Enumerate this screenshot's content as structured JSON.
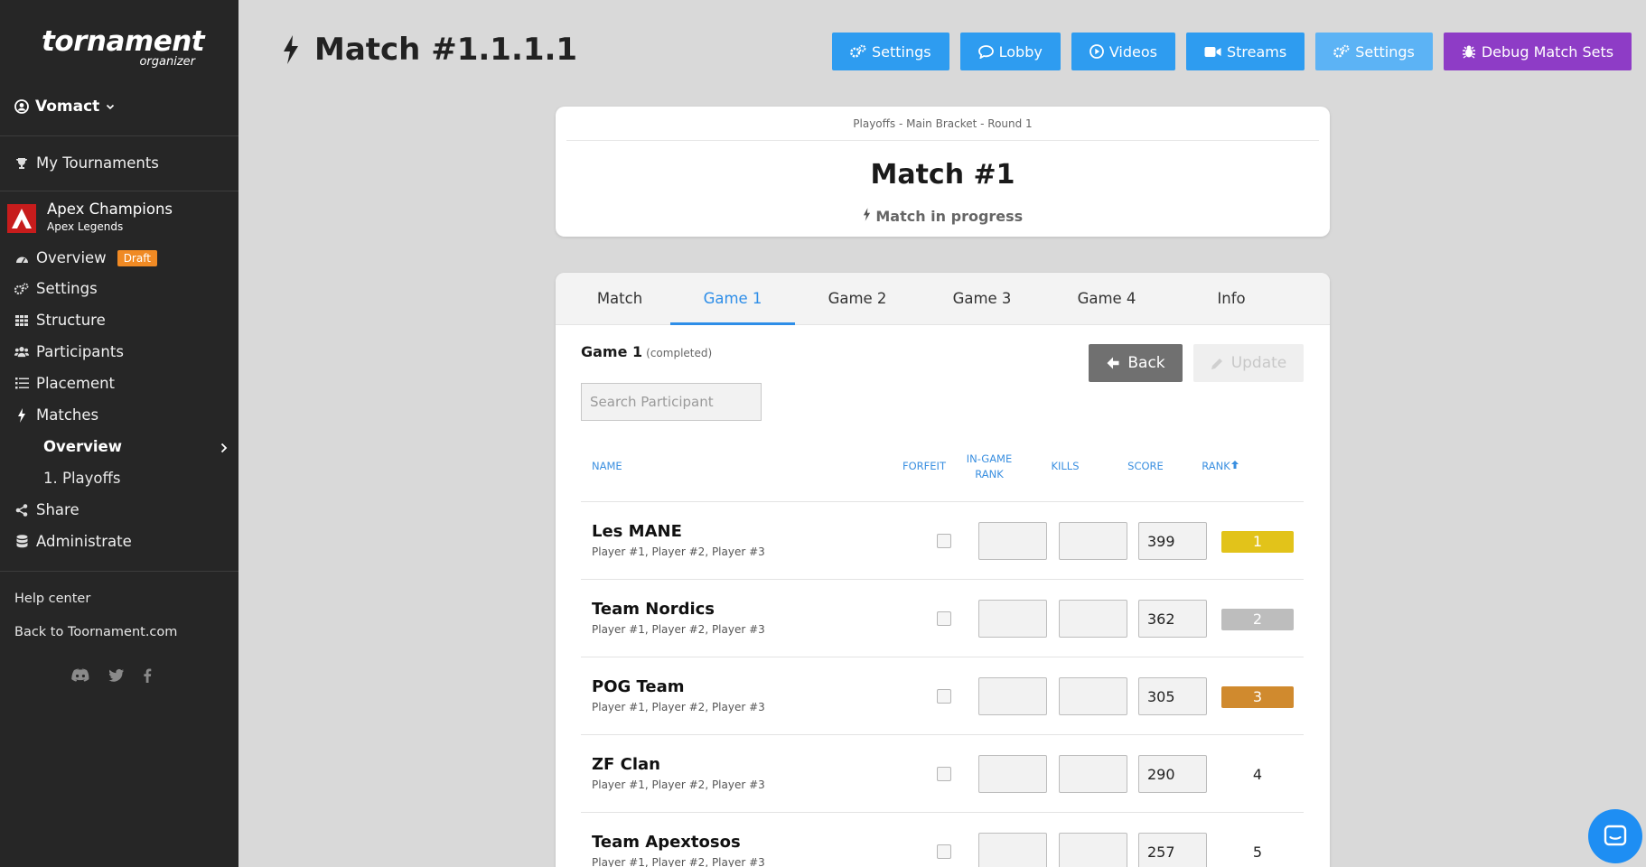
{
  "sidebar": {
    "logo_main": "tornament",
    "logo_sub": "organizer",
    "user": "Vomact",
    "my_tournaments": "My Tournaments",
    "tournament": {
      "name": "Apex Champions",
      "game": "Apex Legends"
    },
    "nav": {
      "overview": "Overview",
      "draft_badge": "Draft",
      "settings": "Settings",
      "structure": "Structure",
      "participants": "Participants",
      "placement": "Placement",
      "matches": "Matches",
      "matches_overview": "Overview",
      "playoffs": "1. Playoffs",
      "share": "Share",
      "administrate": "Administrate"
    },
    "help_center": "Help center",
    "back_link": "Back to Toornament.com"
  },
  "header": {
    "title": "Match #1.1.1.1",
    "buttons": {
      "settings1": "Settings",
      "lobby": "Lobby",
      "videos": "Videos",
      "streams": "Streams",
      "settings2": "Settings",
      "debug": "Debug Match Sets"
    }
  },
  "match_card": {
    "breadcrumb": "Playoffs - Main Bracket - Round 1",
    "title": "Match #1",
    "status": "Match in progress"
  },
  "tabs": [
    "Match",
    "Game 1",
    "Game 2",
    "Game 3",
    "Game 4",
    "Info"
  ],
  "game": {
    "label": "Game 1",
    "state": "(completed)",
    "back": "Back",
    "update": "Update",
    "search_placeholder": "Search Participant"
  },
  "table": {
    "headers": {
      "name": "NAME",
      "forfeit": "FORFEIT",
      "ingame_rank_1": "IN-GAME",
      "ingame_rank_2": "RANK",
      "kills": "KILLS",
      "score": "SCORE",
      "rank": "RANK"
    },
    "rows": [
      {
        "team": "Les MANE",
        "players": "Player #1, Player #2, Player #3",
        "score": "399",
        "rank": "1"
      },
      {
        "team": "Team Nordics",
        "players": "Player #1, Player #2, Player #3",
        "score": "362",
        "rank": "2"
      },
      {
        "team": "POG Team",
        "players": "Player #1, Player #2, Player #3",
        "score": "305",
        "rank": "3"
      },
      {
        "team": "ZF Clan",
        "players": "Player #1, Player #2, Player #3",
        "score": "290",
        "rank": "4"
      },
      {
        "team": "Team Apextosos",
        "players": "Player #1, Player #2, Player #3",
        "score": "257",
        "rank": "5"
      }
    ]
  },
  "colors": {
    "primary": "#2e9cf0",
    "debug": "#8e3cc6",
    "gold": "#e2c31a",
    "silver": "#bdbdbd",
    "bronze": "#d08a2e"
  }
}
